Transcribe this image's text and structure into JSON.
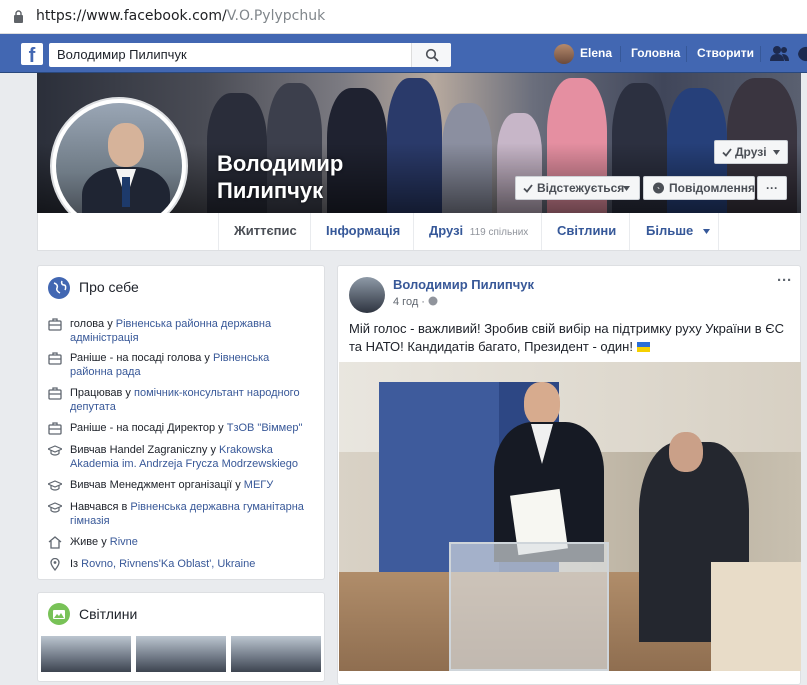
{
  "browser": {
    "url_main": "https://www.facebook.com/",
    "url_muted": "V.O.Pylypchuk"
  },
  "fb": {
    "logo": "f",
    "search_value": "Володимир Пилипчук",
    "nav": {
      "user": "Elena",
      "home": "Головна",
      "create": "Створити"
    }
  },
  "profile": {
    "name_line1": "Володимир",
    "name_line2": "Пилипчук",
    "friends_btn": "Друзі",
    "follow_btn": "Відстежується",
    "message_btn": "Повідомлення",
    "more_btn": "···"
  },
  "tabs": {
    "timeline": "Життєпис",
    "about": "Інформація",
    "friends": "Друзі",
    "friends_count": "119 спільних",
    "photos": "Світлини",
    "more": "Більше"
  },
  "intro": {
    "title": "Про себе",
    "rows": [
      {
        "icon": "briefcase-icon",
        "pre": "голова у ",
        "link": "Рівненська районна державна адміністрація"
      },
      {
        "icon": "briefcase-icon",
        "pre": "Раніше - на посаді голова у ",
        "link": "Рівненська районна рада"
      },
      {
        "icon": "briefcase-icon",
        "pre": "Працював у ",
        "link": "помічник-консультант народного депутата"
      },
      {
        "icon": "briefcase-icon",
        "pre": "Раніше - на посаді Директор у ",
        "link": "ТзОВ \"Віммер\""
      },
      {
        "icon": "graduation-cap-icon",
        "pre": "Вивчав Handel Zagraniczny у ",
        "link": "Krakowska Akademia im. Andrzeja Frycza Modrzewskiego"
      },
      {
        "icon": "graduation-cap-icon",
        "pre": "Вивчав Менеджмент організації у ",
        "link": "МЕГУ"
      },
      {
        "icon": "graduation-cap-icon",
        "pre": "Навчався в ",
        "link": "Рівненська державна гуманітарна гімназія"
      },
      {
        "icon": "home-icon",
        "pre": "Живе у ",
        "link": "Rivne"
      },
      {
        "icon": "location-pin-icon",
        "pre": "Із ",
        "link": "Rovno, Rivnens'Ka Oblast', Ukraine"
      }
    ]
  },
  "photos_card": {
    "title": "Світлини"
  },
  "post": {
    "author": "Володимир Пилипчук",
    "time": "4 год",
    "text": "Мій голос - важливий! Зробив свій вибір на підтримку руху України в ЄС та НАТО! Кандидатів багато, Президент - один!",
    "menu": "···"
  },
  "colors": {
    "fb_blue": "#4267b2",
    "link": "#385898",
    "bg": "#e9ebee"
  }
}
